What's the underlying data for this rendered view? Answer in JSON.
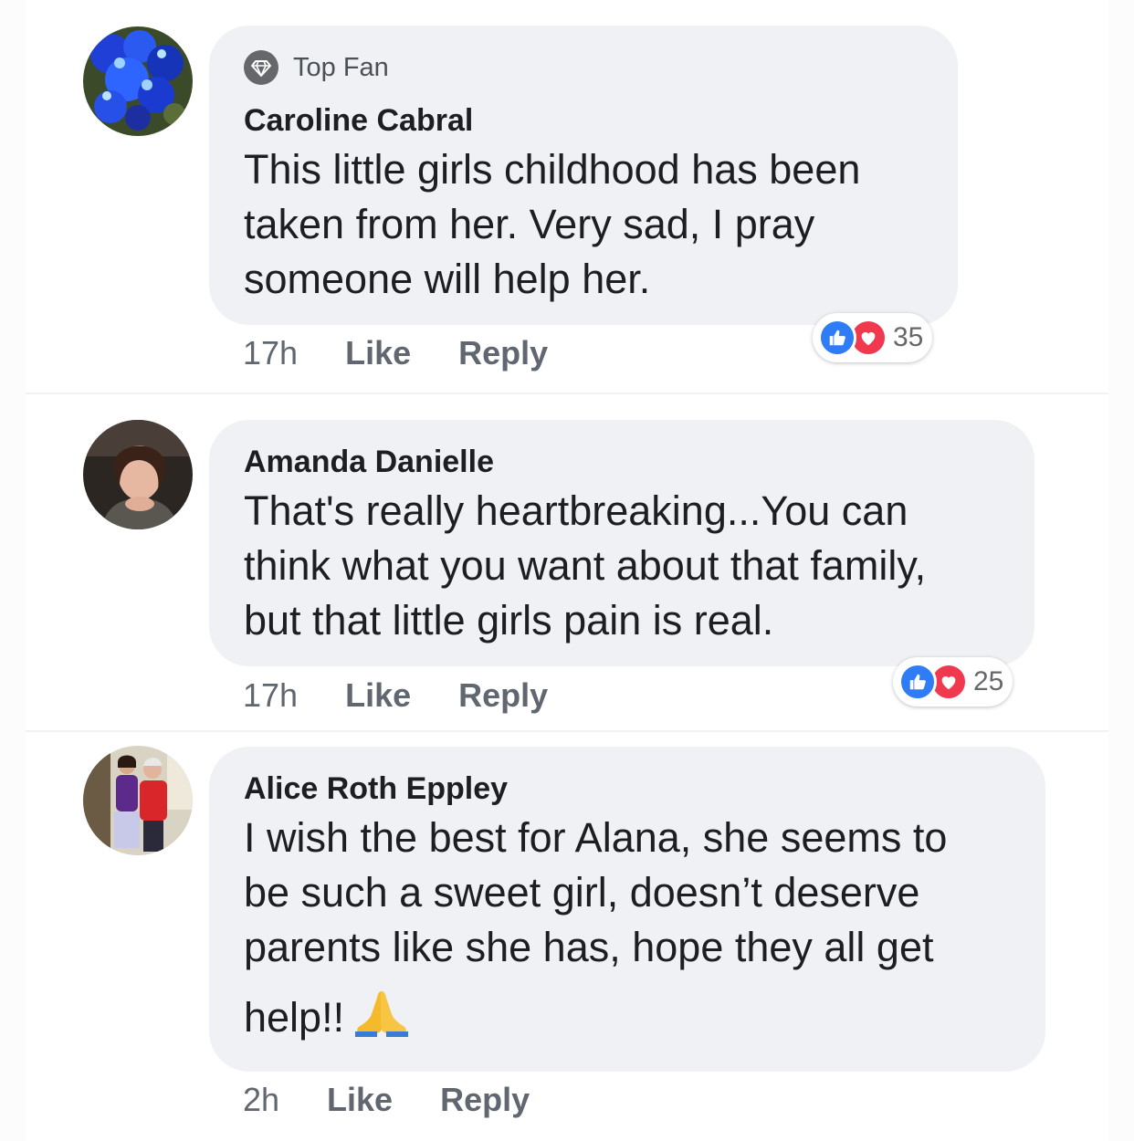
{
  "comments": [
    {
      "badge": "Top Fan",
      "author": "Caroline Cabral",
      "lines": [
        "This little girls childhood has been",
        "taken from her. Very sad, I pray",
        "someone will help her."
      ],
      "time": "17h",
      "like_label": "Like",
      "reply_label": "Reply",
      "reaction_count": "35"
    },
    {
      "author": "Amanda Danielle",
      "lines": [
        "That's really heartbreaking...You can",
        "think what you want about that family,",
        "but that little girls pain is real."
      ],
      "time": "17h",
      "like_label": "Like",
      "reply_label": "Reply",
      "reaction_count": "25"
    },
    {
      "author": "Alice Roth Eppley",
      "lines": [
        "I wish the best for Alana, she seems to",
        "be such a sweet girl, doesn’t deserve",
        "parents like she has, hope they all get",
        "help!!"
      ],
      "emoji": "folded-hands",
      "time": "2h",
      "like_label": "Like",
      "reply_label": "Reply"
    }
  ],
  "colors": {
    "bubble": "#f0f1f4",
    "like_blue": "#2e7cf6",
    "love_red": "#f0394f",
    "meta_gray": "#606770"
  },
  "icons": [
    "top-fan-diamond-icon",
    "like-reaction-icon",
    "love-reaction-icon",
    "folded-hands-emoji"
  ]
}
